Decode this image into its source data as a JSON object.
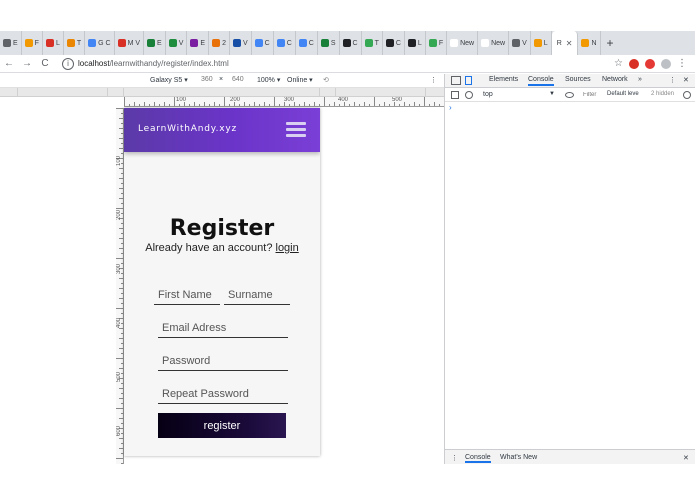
{
  "browser": {
    "tabs": [
      {
        "label": "E",
        "color": "#5f6368"
      },
      {
        "label": "F",
        "color": "#f29900"
      },
      {
        "label": "L",
        "color": "#d93025"
      },
      {
        "label": "T",
        "color": "#ea8600"
      },
      {
        "label": "G C",
        "color": "#4285f4"
      },
      {
        "label": "M V",
        "color": "#d93025"
      },
      {
        "label": "E",
        "color": "#188038"
      },
      {
        "label": "V",
        "color": "#1e8e3e"
      },
      {
        "label": "E",
        "color": "#7b1fa2"
      },
      {
        "label": "2",
        "color": "#e8710a"
      },
      {
        "label": "V",
        "color": "#174ea6"
      },
      {
        "label": "C",
        "color": "#4285f4"
      },
      {
        "label": "C",
        "color": "#4285f4"
      },
      {
        "label": "C",
        "color": "#4285f4"
      },
      {
        "label": "S",
        "color": "#188038"
      },
      {
        "label": "C",
        "color": "#202124"
      },
      {
        "label": "T",
        "color": "#34a853"
      },
      {
        "label": "C",
        "color": "#202124"
      },
      {
        "label": "L",
        "color": "#202124"
      },
      {
        "label": "F",
        "color": "#34a853"
      },
      {
        "label": "New",
        "color": "#ffffff"
      },
      {
        "label": "New",
        "color": "#ffffff"
      },
      {
        "label": "V",
        "color": "#5f6368"
      },
      {
        "label": "L",
        "color": "#f29900"
      }
    ],
    "active_tab": {
      "label": "R",
      "close": "✕"
    },
    "extra_tab": {
      "label": "N",
      "color": "#f29900"
    },
    "new_tab": "+",
    "url_host": "localhost",
    "url_path": "/learnwithandy/register/index.html",
    "nav": {
      "back": "←",
      "forward": "→",
      "reload": "C",
      "info": "i",
      "star": "☆",
      "menu": "⋮"
    }
  },
  "device_toolbar": {
    "device": "Galaxy S5 ▾",
    "width": "360",
    "times": "×",
    "height": "640",
    "zoom": "100% ▾",
    "network": "Online ▾",
    "rotate": "⟲",
    "more": "⋮"
  },
  "ruler": {
    "h_labels": [
      "100",
      "200",
      "300",
      "400",
      "500"
    ],
    "v_labels": [
      "100",
      "200",
      "300",
      "400",
      "500",
      "600"
    ]
  },
  "page": {
    "brand": "LearnWithAndy.xyz",
    "title": "Register",
    "subtitle": "Already have an account?",
    "login_link": "login",
    "first_name_placeholder": "First Name",
    "surname_placeholder": "Surname",
    "email_placeholder": "Email Adress",
    "password_placeholder": "Password",
    "repeat_password_placeholder": "Repeat Password",
    "register_label": "register",
    "header_color_start": "#5b3aa8",
    "header_color_end": "#7a3fd6"
  },
  "devtools": {
    "tabs": [
      "Elements",
      "Console",
      "Sources",
      "Network",
      "»"
    ],
    "active_tab": "Console",
    "context": "top",
    "filter_placeholder": "Filter",
    "levels": "Default leve",
    "hidden": "2 hidden",
    "prompt": "›",
    "drawer_tabs": [
      "Console",
      "What's New"
    ],
    "close": "✕",
    "kebab": "⋮"
  }
}
